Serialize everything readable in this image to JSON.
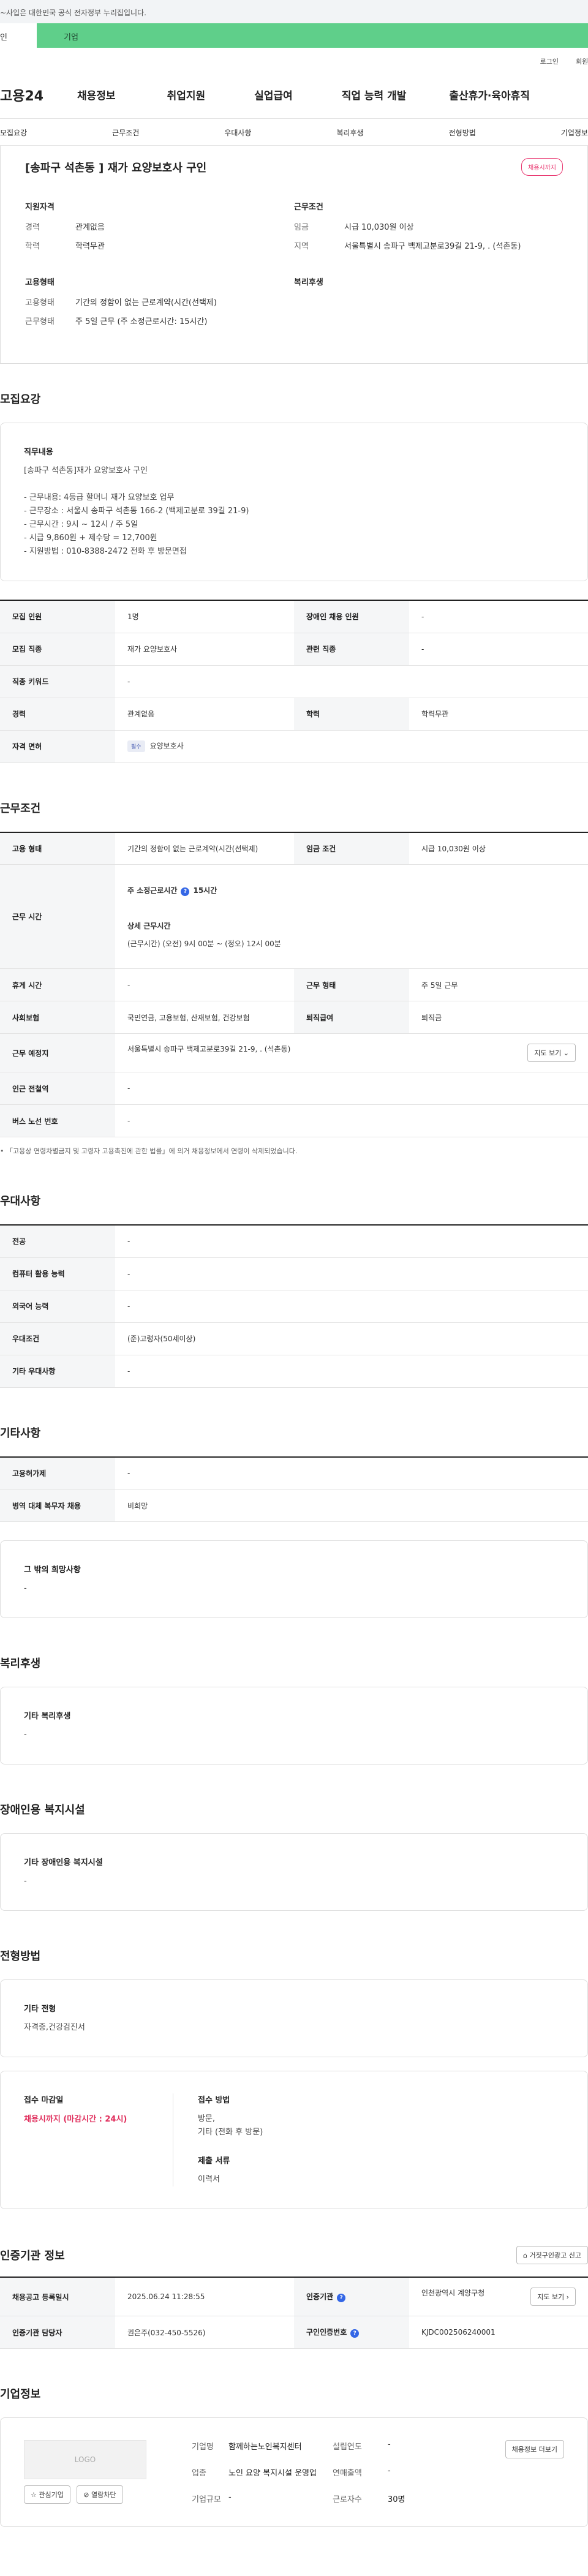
{
  "gov_notice": "~사입은 대한민국 공식 전자정부 누리집입니다.",
  "top_tabs": [
    "인",
    "기업"
  ],
  "util_links": [
    "로그인",
    "회원"
  ],
  "nav": {
    "logo": "고용24",
    "menus": [
      "채용정보",
      "취업지원",
      "실업급여",
      "직업 능력 개발",
      "출산휴가·육아휴직"
    ],
    "sub": [
      "모집요강",
      "근무조건",
      "우대사항",
      "복리후생",
      "전형방법",
      "기업정보"
    ]
  },
  "job": {
    "title": "[송파구 석촌동 ] 재가 요양보호사 구인",
    "badge": "채용시까지"
  },
  "summary": {
    "qual": {
      "h": "지원자격",
      "rows": [
        {
          "k": "경력",
          "v": "관계없음"
        },
        {
          "k": "학력",
          "v": "학력무관"
        }
      ]
    },
    "cond": {
      "h": "근무조건",
      "rows": [
        {
          "k": "임금",
          "v": "시급 10,030원 이상"
        },
        {
          "k": "지역",
          "v": "서울특별시 송파구 백제고분로39길 21-9, . (석촌동)"
        }
      ]
    },
    "emp": {
      "h": "고용형태",
      "rows": [
        {
          "k": "고용형태",
          "v": "기간의 정함이 없는 근로계약(시간(선택제)"
        },
        {
          "k": "근무형태",
          "v": "주 5일 근무 (주 소정근로시간: 15시간)"
        }
      ]
    },
    "welfare": {
      "h": "복리후생"
    }
  },
  "recruit": {
    "title": "모집요강",
    "card_h": "직무내용",
    "card_body": "[송파구 석촌동]재가 요양보호사 구인\n\n- 근무내용: 4등급 할머니 재가 요양보호 업무\n- 근무장소 : 서울시 송파구 석촌동 166-2 (백제고분로 39길 21-9)\n- 근무시간 : 9시 ~ 12시  / 주 5일\n- 시급 9,860원 + 제수당 = 12,700원\n- 지원방법 : 010-8388-2472 전화 후 방문면접",
    "rows": [
      [
        "모집 인원",
        "1명",
        "장애인 채용 인원",
        "-"
      ],
      [
        "모집 직종",
        "재가 요양보호사",
        "관련 직종",
        "-"
      ],
      [
        "직종 키워드",
        "-"
      ],
      [
        "경력",
        "관계없음",
        "학력",
        "학력무관"
      ],
      [
        "자격 면허",
        "요양보호사"
      ]
    ],
    "license_tag": "필수"
  },
  "work": {
    "title": "근무조건",
    "emp_k": "고용 형태",
    "emp_v": "기간의 정함이 없는 근로계약(시간(선택제)",
    "wage_k": "임금 조건",
    "wage_v": "시급 10,030원 이상",
    "time_k": "근무 시간",
    "time_label": "주 소정근로시간",
    "time_hours": "15시간",
    "time_detail_h": "상세 근무시간",
    "time_detail": "(근무시간) (오전) 9시 00분 ~ (정오) 12시 00분",
    "rows": [
      [
        "휴게 시간",
        "-",
        "근무 형태",
        "주 5일 근무"
      ],
      [
        "사회보험",
        "국민연금, 고용보험, 산재보험, 건강보험",
        "퇴직급여",
        "퇴직금"
      ]
    ],
    "place_k": "근무 예정지",
    "place_v": "서울특별시 송파구 백제고분로39길 21-9, . (석촌동)",
    "map_btn": "지도 보기",
    "subway_k": "인근 전철역",
    "subway_v": "-",
    "bus_k": "버스 노선 번호",
    "bus_v": "-",
    "note": "「고용상 연령차별금지 및 고령자 고용촉진에 관한 법률」에 의거 채용정보에서 연령이 삭제되었습니다."
  },
  "pref": {
    "title": "우대사항",
    "rows": [
      [
        "전공",
        "-"
      ],
      [
        "컴퓨터 활용 능력",
        "-"
      ],
      [
        "외국어 능력",
        "-"
      ],
      [
        "우대조건",
        "(준)고령자(50세이상)"
      ],
      [
        "기타 우대사항",
        "-"
      ]
    ]
  },
  "etc": {
    "title": "기타사항",
    "rows": [
      [
        "고용허가제",
        "-"
      ],
      [
        "병역 대체 복무자 채용",
        "비희망"
      ]
    ],
    "card_h": "그 밖의 희망사항",
    "card_body": "-"
  },
  "benefit": {
    "title": "복리후생",
    "card_h": "기타 복리후생",
    "card_body": "-"
  },
  "disabled": {
    "title": "장애인용 복지시설",
    "card_h": "기타 장애인용 복지시설",
    "card_body": "-"
  },
  "screening": {
    "title": "전형방법",
    "card_h": "기타 전형",
    "card_body": "자격증,건강검진서",
    "deadline_h": "접수 마감일",
    "deadline_v": "채용시까지 (마감시간 : 24시)",
    "method_h": "접수 방법",
    "method_v": "방문,\n기타 (전화 후 방문)",
    "docs_h": "제출 서류",
    "docs_v": "이력서"
  },
  "cert": {
    "title": "인증기관 정보",
    "report_btn": "거짓구인광고 신고",
    "rows": [
      [
        "채용공고 등록일시",
        "2025.06.24 11:28:55",
        "인증기관",
        "인천광역시 계양구청"
      ],
      [
        "인증기관 담당자",
        "권은주(032-450-5526)",
        "구인인증번호",
        "KJDC002506240001"
      ]
    ],
    "map_btn": "지도 보기"
  },
  "company": {
    "title": "기업정보",
    "logo": "LOGO",
    "fav_btn": "관심기업",
    "noti_btn": "열람차단",
    "rows": [
      {
        "k": "기업명",
        "v": "함께하는노인복지센터",
        "k2": "설립연도",
        "v2": "-"
      },
      {
        "k": "업종",
        "v": "노인 요양 복지시설 운영업",
        "k2": "연매출액",
        "v2": "-"
      },
      {
        "k": "기업규모",
        "v": "-",
        "k2": "근로자수",
        "v2": "30명"
      }
    ],
    "jobs_btn": "채용정보 더보기"
  }
}
